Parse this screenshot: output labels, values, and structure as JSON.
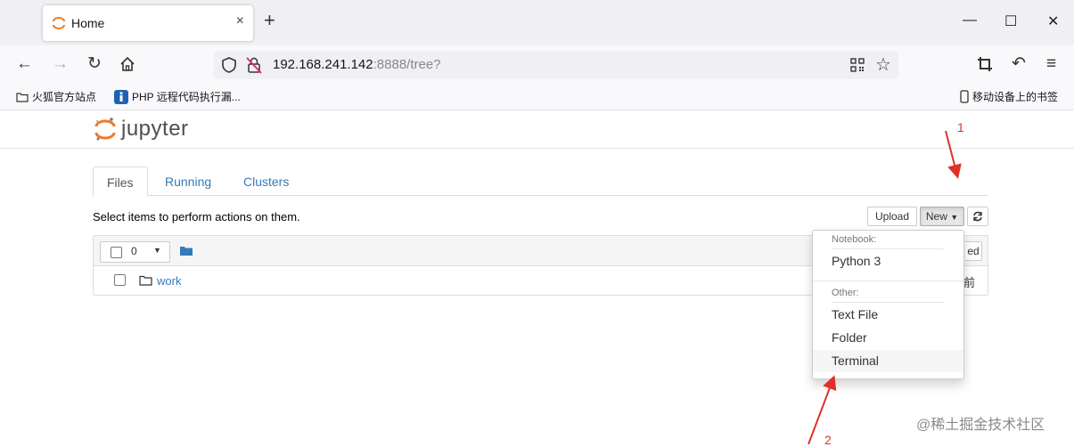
{
  "browser": {
    "tab_title": "Home",
    "tab_close": "×",
    "new_tab": "+",
    "window_controls": {
      "minimize": "—",
      "maximize": "☐",
      "close": "✕"
    },
    "url_host": "192.168.241.142",
    "url_rest": ":8888/tree?",
    "bookmarks": [
      {
        "label": "火狐官方站点",
        "icon": "folder-icon"
      },
      {
        "label": "PHP 远程代码执行漏...",
        "icon": "bookmark-favicon"
      }
    ],
    "mobile_bookmarks": "移动设备上的书签"
  },
  "jupyter": {
    "logo_text": "jupyter",
    "tabs": [
      {
        "label": "Files",
        "active": true
      },
      {
        "label": "Running",
        "active": false
      },
      {
        "label": "Clusters",
        "active": false
      }
    ],
    "hint": "Select items to perform actions on them.",
    "upload_label": "Upload",
    "new_label": "New",
    "selected_count": "0",
    "files": [
      {
        "name": "work",
        "modified_partial": "前"
      }
    ],
    "header_partial": "ed"
  },
  "new_menu": {
    "notebook_header": "Notebook:",
    "notebook_items": [
      "Python 3"
    ],
    "other_header": "Other:",
    "other_items": [
      "Text File",
      "Folder",
      "Terminal"
    ]
  },
  "annotations": {
    "arrow1": "1",
    "arrow2": "2"
  },
  "watermark": "@稀土掘金技术社区",
  "colors": {
    "link": "#337ab7",
    "jupyter_orange": "#f37726",
    "annotation_red": "#e0302a"
  }
}
